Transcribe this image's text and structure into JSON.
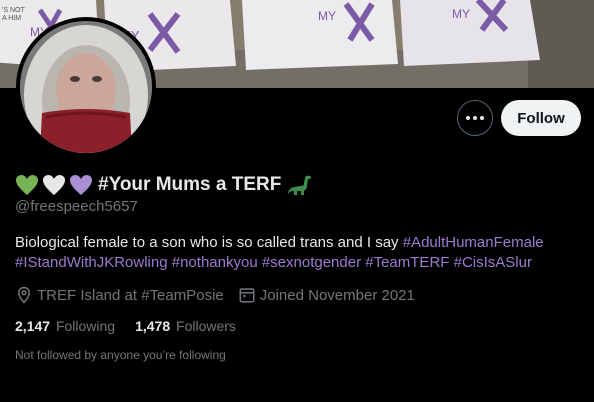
{
  "banner": {
    "sign_texts": [
      "MY",
      "MY",
      "MY",
      "MY"
    ],
    "colors": {
      "sign_bg": "#e9e6ea",
      "sign_mark": "#7b5aa6"
    }
  },
  "profile": {
    "display_name": "#Your Mums a TERF",
    "handle": "@freespeech5657",
    "name_emojis": [
      "green-heart",
      "white-heart",
      "purple-heart"
    ],
    "trailing_emoji": "sauropod"
  },
  "actions": {
    "follow_label": "Follow",
    "more_icon": "more-horizontal-icon"
  },
  "bio": {
    "text": "Biological female to a son who is so called trans and I say ",
    "hashtags": [
      "#AdultHumanFemale",
      "#IStandWithJKRowling",
      "#nothankyou",
      "#sexnotgender",
      "#TeamTERF",
      "#CisIsASlur"
    ]
  },
  "meta": {
    "location": "TREF Island at #TeamPosie",
    "joined": "Joined November 2021"
  },
  "stats": {
    "following_count": "2,147",
    "following_label": "Following",
    "followers_count": "1,478",
    "followers_label": "Followers"
  },
  "footer": {
    "not_followed": "Not followed by anyone you’re following"
  },
  "colors": {
    "background": "#000000",
    "text": "#e7e9ea",
    "muted": "#71767b",
    "hashtag": "#9a7bd0",
    "follow_bg": "#eff3f4"
  }
}
